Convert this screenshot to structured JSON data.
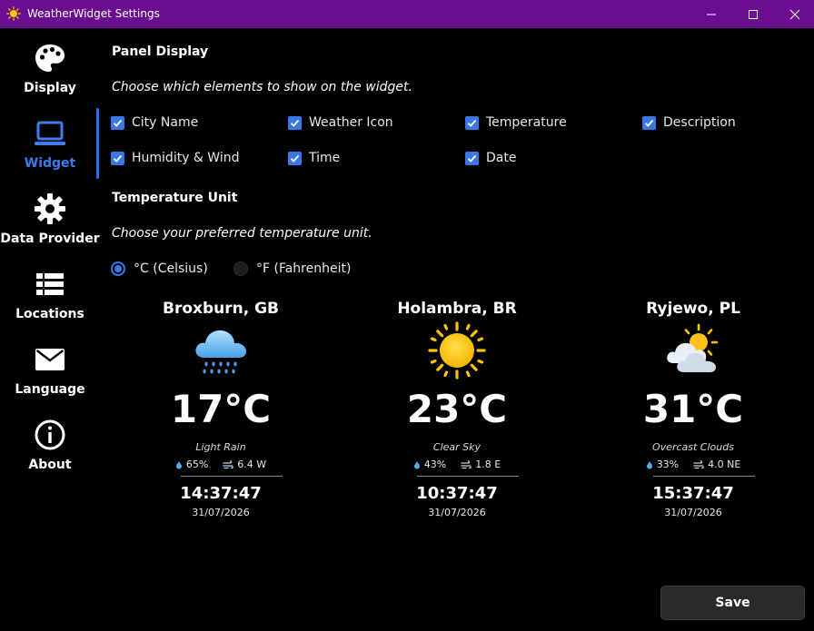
{
  "window": {
    "title": "WeatherWidget Settings",
    "icon": "sun-icon"
  },
  "sidebar": {
    "items": [
      {
        "label": "Display",
        "icon": "palette-icon"
      },
      {
        "label": "Widget",
        "icon": "laptop-icon",
        "active": true
      },
      {
        "label": "Data Provider",
        "icon": "gear-icon"
      },
      {
        "label": "Locations",
        "icon": "list-icon"
      },
      {
        "label": "Language",
        "icon": "envelope-icon"
      },
      {
        "label": "About",
        "icon": "info-icon"
      }
    ],
    "accent_color": "#3d7cf0"
  },
  "panel_display": {
    "title": "Panel Display",
    "description": "Choose which elements to show on the widget.",
    "options": [
      {
        "label": "City Name",
        "checked": true
      },
      {
        "label": "Weather Icon",
        "checked": true
      },
      {
        "label": "Temperature",
        "checked": true
      },
      {
        "label": "Description",
        "checked": true
      },
      {
        "label": "Humidity & Wind",
        "checked": true
      },
      {
        "label": "Time",
        "checked": true
      },
      {
        "label": "Date",
        "checked": true
      }
    ]
  },
  "temperature_unit": {
    "title": "Temperature Unit",
    "description": "Choose your preferred temperature unit.",
    "options": [
      {
        "label": "°C (Celsius)",
        "selected": true
      },
      {
        "label": "°F (Fahrenheit)",
        "selected": false
      }
    ]
  },
  "previews": [
    {
      "city": "Broxburn, GB",
      "icon": "rain-cloud-icon",
      "temperature": "17°C",
      "description": "Light Rain",
      "humidity": "65%",
      "wind": "6.4 W",
      "time": "14:37:47",
      "date": "31/07/2026"
    },
    {
      "city": "Holambra, BR",
      "icon": "sun-icon",
      "temperature": "23°C",
      "description": "Clear Sky",
      "humidity": "43%",
      "wind": "1.8 E",
      "time": "10:37:47",
      "date": "31/07/2026"
    },
    {
      "city": "Ryjewo, PL",
      "icon": "partly-cloudy-icon",
      "temperature": "31°C",
      "description": "Overcast Clouds",
      "humidity": "33%",
      "wind": "4.0 NE",
      "time": "15:37:47",
      "date": "31/07/2026"
    }
  ],
  "footer": {
    "save_label": "Save"
  },
  "colors": {
    "titlebar": "#6a0d8f",
    "checkbox": "#3a78e8",
    "background": "#000000"
  }
}
